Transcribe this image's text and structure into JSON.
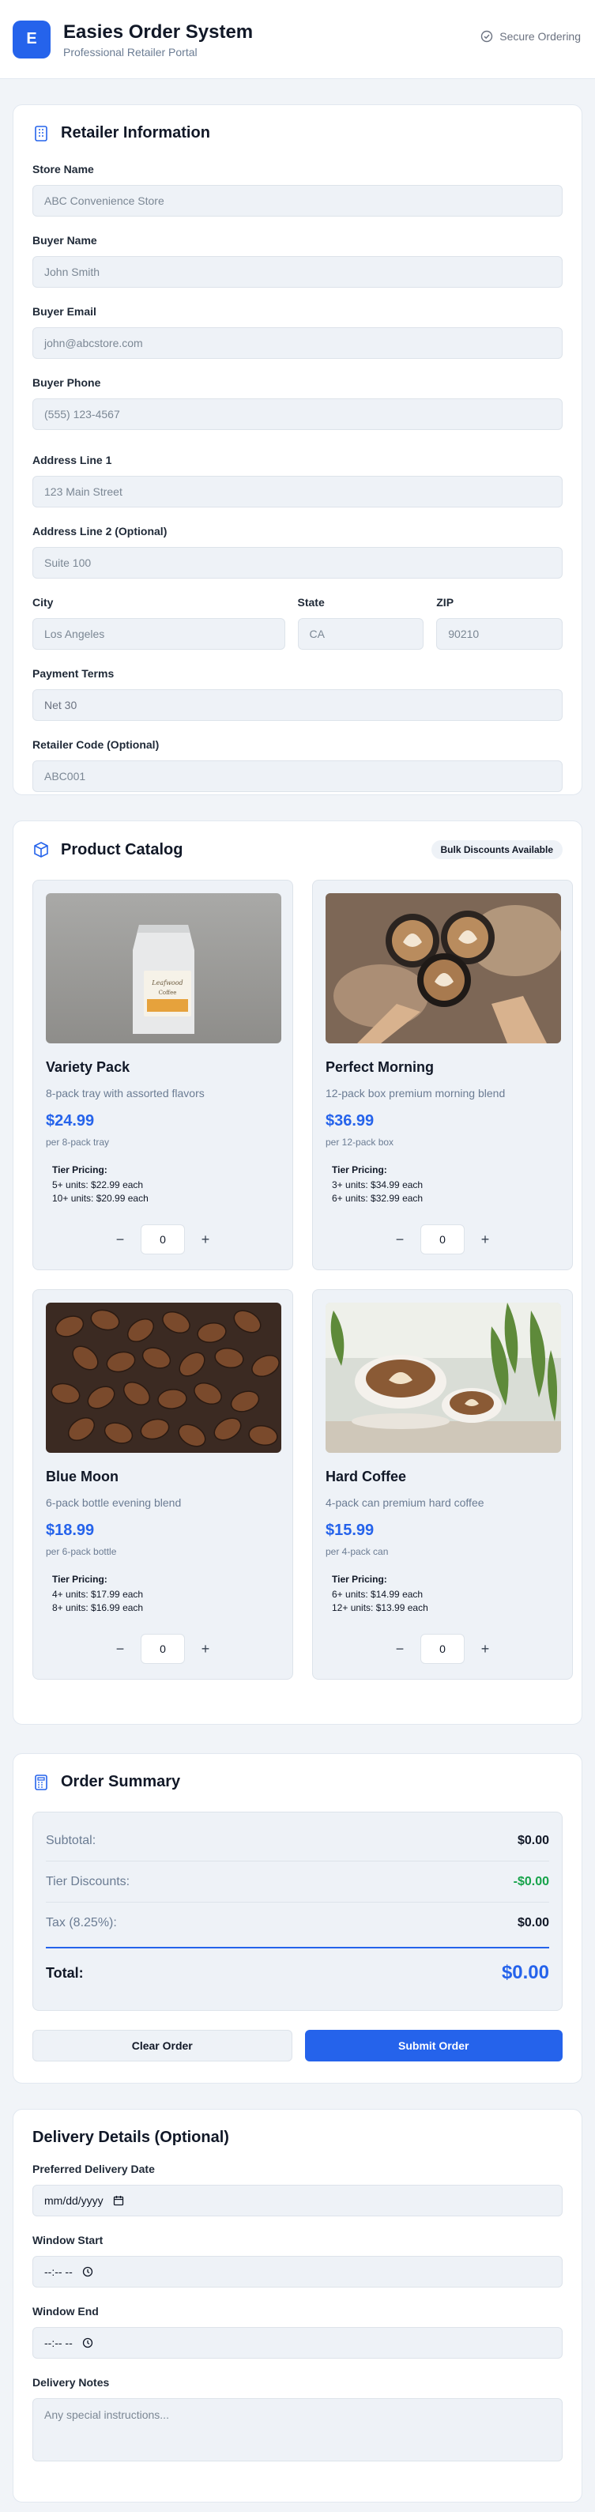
{
  "header": {
    "logo_letter": "E",
    "title": "Easies Order System",
    "subtitle": "Professional Retailer Portal",
    "secure_label": "Secure Ordering"
  },
  "retailer": {
    "title": "Retailer Information",
    "fields": {
      "store_name": {
        "label": "Store Name",
        "placeholder": "ABC Convenience Store"
      },
      "buyer_name": {
        "label": "Buyer Name",
        "placeholder": "John Smith"
      },
      "buyer_email": {
        "label": "Buyer Email",
        "placeholder": "john@abcstore.com"
      },
      "buyer_phone": {
        "label": "Buyer Phone",
        "placeholder": "(555) 123-4567"
      },
      "address1": {
        "label": "Address Line 1",
        "placeholder": "123 Main Street"
      },
      "address2": {
        "label": "Address Line 2 (Optional)",
        "placeholder": "Suite 100"
      },
      "city": {
        "label": "City",
        "placeholder": "Los Angeles"
      },
      "state": {
        "label": "State",
        "placeholder": "CA"
      },
      "zip": {
        "label": "ZIP",
        "placeholder": "90210"
      },
      "payment_terms": {
        "label": "Payment Terms",
        "value": "Net 30"
      },
      "retailer_code": {
        "label": "Retailer Code (Optional)",
        "placeholder": "ABC001"
      }
    }
  },
  "catalog": {
    "title": "Product Catalog",
    "badge": "Bulk Discounts Available",
    "tier_heading": "Tier Pricing:",
    "products": [
      {
        "name": "Variety Pack",
        "desc": "8-pack tray with assorted flavors",
        "price": "$24.99",
        "unit": "per 8-pack tray",
        "tiers": [
          "5+ units: $22.99 each",
          "10+ units: $20.99 each"
        ],
        "qty": "0"
      },
      {
        "name": "Perfect Morning",
        "desc": "12-pack box premium morning blend",
        "price": "$36.99",
        "unit": "per 12-pack box",
        "tiers": [
          "3+ units: $34.99 each",
          "6+ units: $32.99 each"
        ],
        "qty": "0"
      },
      {
        "name": "Blue Moon",
        "desc": "6-pack bottle evening blend",
        "price": "$18.99",
        "unit": "per 6-pack bottle",
        "tiers": [
          "4+ units: $17.99 each",
          "8+ units: $16.99 each"
        ],
        "qty": "0"
      },
      {
        "name": "Hard Coffee",
        "desc": "4-pack can premium hard coffee",
        "price": "$15.99",
        "unit": "per 4-pack can",
        "tiers": [
          "6+ units: $14.99 each",
          "12+ units: $13.99 each"
        ],
        "qty": "0"
      }
    ],
    "minus": "−",
    "plus": "+"
  },
  "summary": {
    "title": "Order Summary",
    "subtotal_label": "Subtotal:",
    "subtotal": "$0.00",
    "discount_label": "Tier Discounts:",
    "discount": "-$0.00",
    "tax_label": "Tax (8.25%):",
    "tax": "$0.00",
    "total_label": "Total:",
    "total": "$0.00",
    "clear_label": "Clear Order",
    "submit_label": "Submit Order"
  },
  "delivery": {
    "title": "Delivery Details (Optional)",
    "date_label": "Preferred Delivery Date",
    "date_value": "mm/dd/yyyy",
    "start_label": "Window Start",
    "start_value": "--:-- --",
    "end_label": "Window End",
    "end_value": "--:-- --",
    "notes_label": "Delivery Notes",
    "notes_placeholder": "Any special instructions..."
  },
  "colors": {
    "accent": "#2563eb",
    "green": "#16a34a"
  }
}
